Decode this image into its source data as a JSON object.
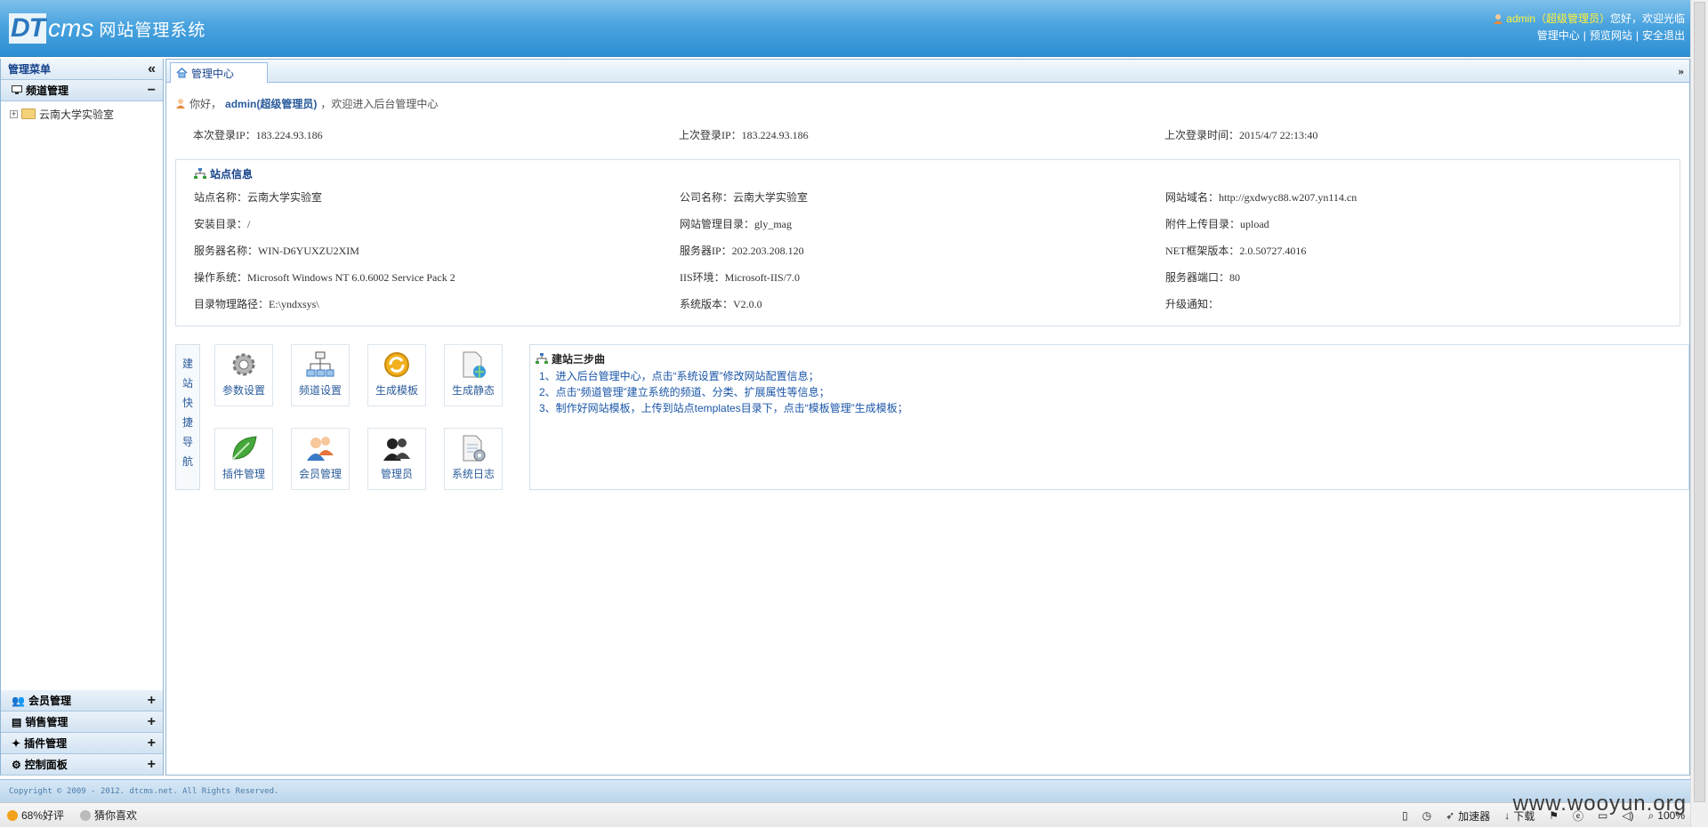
{
  "header": {
    "logo_dt": "DT",
    "logo_cms": "cms",
    "logo_system": "网站管理系统",
    "user_name": "admin",
    "user_role": "（超级管理员）",
    "greeting": "您好，欢迎光临",
    "links": [
      "管理中心",
      "预览网站",
      "安全退出"
    ]
  },
  "sidebar": {
    "title": "管理菜单",
    "active_group": "频道管理",
    "tree_item": "云南大学实验室",
    "groups": [
      "会员管理",
      "销售管理",
      "插件管理",
      "控制面板"
    ]
  },
  "tabs": {
    "home": "管理中心"
  },
  "welcome": {
    "prefix": "你好，",
    "admin": "admin(超级管理员)",
    "suffix": "，欢迎进入后台管理中心"
  },
  "login": {
    "current_ip": "本次登录IP：183.224.93.186",
    "last_ip": "上次登录IP：183.224.93.186",
    "last_time": "上次登录时间：2015/4/7 22:13:40"
  },
  "site_info": {
    "title": "站点信息",
    "rows": [
      [
        "站点名称：云南大学实验室",
        "公司名称：云南大学实验室",
        "网站域名：http://gxdwyc88.w207.yn114.cn"
      ],
      [
        "安装目录：/",
        "网站管理目录：gly_mag",
        "附件上传目录：upload"
      ],
      [
        "服务器名称：WIN-D6YUXZU2XIM",
        "服务器IP：202.203.208.120",
        "NET框架版本：2.0.50727.4016"
      ],
      [
        "操作系统：Microsoft Windows NT 6.0.6002 Service Pack 2",
        "IIS环境：Microsoft-IIS/7.0",
        "服务器端口：80"
      ],
      [
        "目录物理路径：E:\\yndxsys\\",
        "系统版本：V2.0.0",
        "升级通知："
      ]
    ]
  },
  "quick_nav": {
    "label": "建站快捷导航",
    "buttons": [
      {
        "label": "参数设置",
        "icon": "gear-icon",
        "color": "#9a9a9a"
      },
      {
        "label": "频道设置",
        "icon": "sitemap-icon",
        "color": "#5b8fc9"
      },
      {
        "label": "生成模板",
        "icon": "refresh-icon",
        "color": "#f0a81c"
      },
      {
        "label": "生成静态",
        "icon": "document-globe-icon",
        "color": "#7fb6e0"
      },
      {
        "label": "插件管理",
        "icon": "leaf-icon",
        "color": "#3fa33a"
      },
      {
        "label": "会员管理",
        "icon": "users-icon",
        "color": "#e07a3a"
      },
      {
        "label": "管理员",
        "icon": "admin-users-icon",
        "color": "#2b2b2b"
      },
      {
        "label": "系统日志",
        "icon": "log-icon",
        "color": "#8fb8d8"
      }
    ]
  },
  "steps": {
    "title": "建站三步曲",
    "items": [
      "1、进入后台管理中心，点击“系统设置”修改网站配置信息；",
      "2、点击“频道管理”建立系统的频道、分类、扩展属性等信息；",
      "3、制作好网站模板，上传到站点templates目录下，点击“模板管理”生成模板；"
    ]
  },
  "footer": {
    "copyright": "Copyright © 2009 - 2012. dtcms.net. All Rights Reserved."
  },
  "statusbar": {
    "rating": "68%好评",
    "guess": "猜你喜欢",
    "accelerator": "加速器",
    "download": "下载",
    "zoom": "100%"
  },
  "watermark": "www.wooyun.org",
  "colors": {
    "header_blue": "#2f8fd3",
    "link_blue": "#15428b",
    "username_yellow": "#fff23a"
  }
}
